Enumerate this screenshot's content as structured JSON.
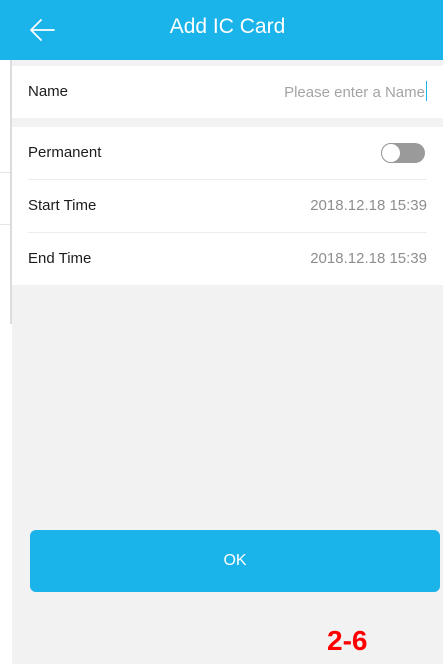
{
  "header": {
    "title": "Add IC Card",
    "back_icon": "back-arrow-icon"
  },
  "name_row": {
    "label": "Name",
    "placeholder": "Please enter a Name",
    "value": ""
  },
  "permanent_row": {
    "label": "Permanent",
    "enabled": false
  },
  "start_row": {
    "label": "Start Time",
    "value": "2018.12.18 15:39"
  },
  "end_row": {
    "label": "End Time",
    "value": "2018.12.18 15:39"
  },
  "ok_button": {
    "label": "OK"
  },
  "caption": "2-6",
  "colors": {
    "accent": "#1ab3ea",
    "caption": "#ff0000",
    "toggle_off": "#9a9a9a"
  }
}
